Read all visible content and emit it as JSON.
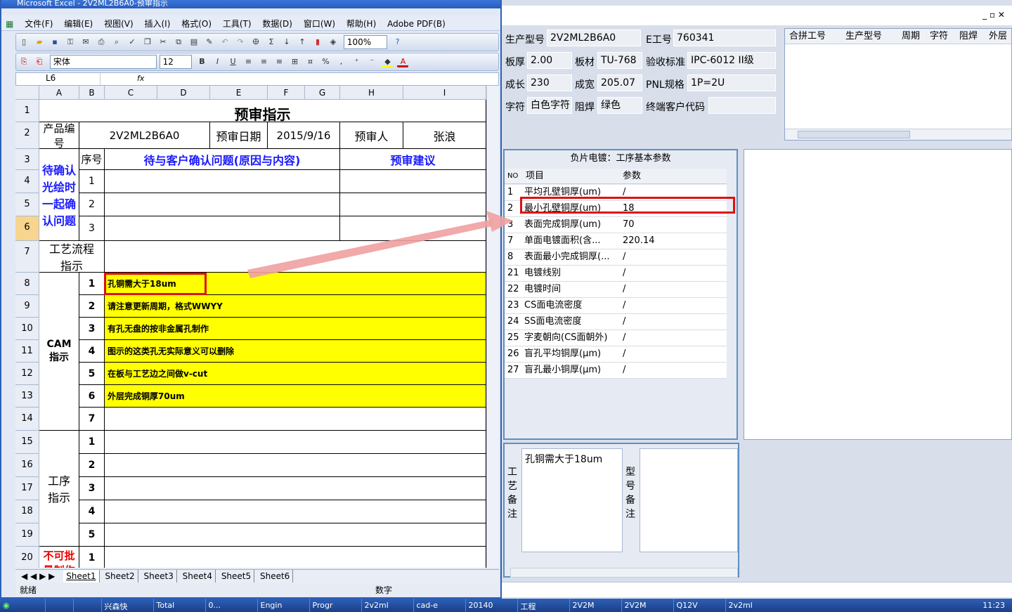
{
  "excel": {
    "title": "Microsoft Excel - 2V2ML2B6A0-预审指示",
    "menu": [
      "文件(F)",
      "编辑(E)",
      "视图(V)",
      "插入(I)",
      "格式(O)",
      "工具(T)",
      "数据(D)",
      "窗口(W)",
      "帮助(H)",
      "Adobe PDF(B)"
    ],
    "zoom": "100%",
    "font": "宋体",
    "font_size": "12",
    "name_box": "L6",
    "fx": "fx",
    "columns": [
      "A",
      "B",
      "C",
      "D",
      "E",
      "F",
      "G",
      "H",
      "I"
    ],
    "rows": [
      "1",
      "2",
      "3",
      "4",
      "5",
      "6",
      "7",
      "8",
      "9",
      "10",
      "11",
      "12",
      "13",
      "14",
      "15",
      "16",
      "17",
      "18",
      "19",
      "20"
    ],
    "sheet_title": "预审指示",
    "product_label": "产品编号",
    "product_value": "2V2ML2B6A0",
    "date_label": "预审日期",
    "date_value": "2015/9/16",
    "reviewer_label": "预审人",
    "reviewer_value": "张浪",
    "seq_label": "序号",
    "issue_header": "待与客户确认问题(原因与内容)",
    "advice_header": "预审建议",
    "pending_label": "待确认光绘时一起确认问题",
    "process_label": "工艺流程指示",
    "cam_label": "CAM指示",
    "cam_items": [
      "孔铜需大于18um",
      "请注意更新周期，格式WWYY",
      "有孔无盘的按非金属孔制作",
      "图示的这类孔无实际意义可以删除",
      "在板与工艺边之间做v-cut",
      "外层完成铜厚70um",
      ""
    ],
    "op_label": "工序指示",
    "nobatch_label": "不可批量制作",
    "sheets": [
      "Sheet1",
      "Sheet2",
      "Sheet3",
      "Sheet4",
      "Sheet5",
      "Sheet6"
    ],
    "status": "就绪",
    "status_mode": "数字"
  },
  "app": {
    "model_label": "生产型号",
    "model_value": "2V2ML2B6A0",
    "eno_label": "E工号",
    "eno_value": "760341",
    "thick_label": "板厚",
    "thick_value": "2.00",
    "material_label": "板材",
    "material_value": "TU-768",
    "std_label": "验收标准",
    "std_value": "IPC-6012 II级",
    "len_label": "成长",
    "len_value": "230",
    "wid_label": "成宽",
    "wid_value": "205.07",
    "pnl_label": "PNL规格",
    "pnl_value": "1P=2U",
    "char_label": "字符",
    "char_value": "白色字符",
    "mask_label": "阻焊",
    "mask_value": "绿色",
    "cust_label": "终端客户代码",
    "cust_value": "",
    "list_cols": [
      "合拼工号",
      "生产型号",
      "周期",
      "字符",
      "阻焊",
      "外层"
    ],
    "panel_title": "负片电镀：工序基本参数",
    "param_cols": [
      "NO",
      "项目",
      "参数"
    ],
    "params": [
      {
        "no": "1",
        "item": "平均孔壁铜厚(um)",
        "val": "/"
      },
      {
        "no": "2",
        "item": "最小孔壁铜厚(um)",
        "val": "18"
      },
      {
        "no": "3",
        "item": "表面完成铜厚(um)",
        "val": "70"
      },
      {
        "no": "7",
        "item": "单面电镀面积(含...",
        "val": "220.14"
      },
      {
        "no": "8",
        "item": "表面最小完成铜厚(...",
        "val": "/"
      },
      {
        "no": "21",
        "item": "电镀线别",
        "val": "/"
      },
      {
        "no": "22",
        "item": "电镀时间",
        "val": "/"
      },
      {
        "no": "23",
        "item": "CS面电流密度",
        "val": "/"
      },
      {
        "no": "24",
        "item": "SS面电流密度",
        "val": "/"
      },
      {
        "no": "25",
        "item": "字麦朝向(CS面朝外)",
        "val": "/"
      },
      {
        "no": "26",
        "item": "盲孔平均铜厚(μm)",
        "val": "/"
      },
      {
        "no": "27",
        "item": "盲孔最小铜厚(μm)",
        "val": "/"
      }
    ],
    "proc_note_label": "工艺备注",
    "proc_note": "孔铜需大于18um",
    "model_note_label": "型号备注",
    "model_note": ""
  },
  "taskbar": [
    "",
    "",
    "兴森快",
    "Total",
    "0...",
    "Engin",
    "Progr",
    "2v2ml",
    "cad-e",
    "20140",
    "工程",
    "2V2M",
    "2V2M",
    "Q12V",
    "2v2ml"
  ],
  "clock": "11:23"
}
